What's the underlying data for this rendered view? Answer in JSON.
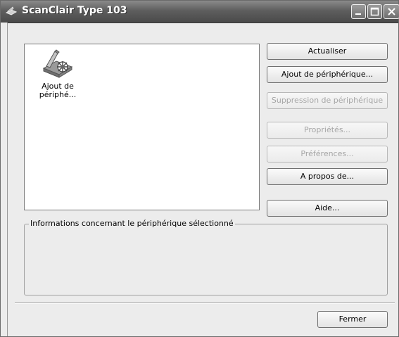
{
  "window": {
    "title": "ScanClair Type 103"
  },
  "device_list": {
    "items": [
      {
        "label": "Ajout de périphé...",
        "icon": "scanner-add-icon"
      }
    ]
  },
  "buttons": {
    "refresh": "Actualiser",
    "add_device": "Ajout de périphérique...",
    "remove_device": "Suppression de périphérique",
    "properties": "Propriétés...",
    "preferences": "Préférences...",
    "about": "A propos de...",
    "help": "Aide...",
    "close": "Fermer"
  },
  "info_group": {
    "legend": "Informations concernant le périphérique sélectionné"
  },
  "colors": {
    "titlebar": "#5e5e5e",
    "window_bg": "#ececec",
    "disabled_text": "#a6a6a6"
  }
}
